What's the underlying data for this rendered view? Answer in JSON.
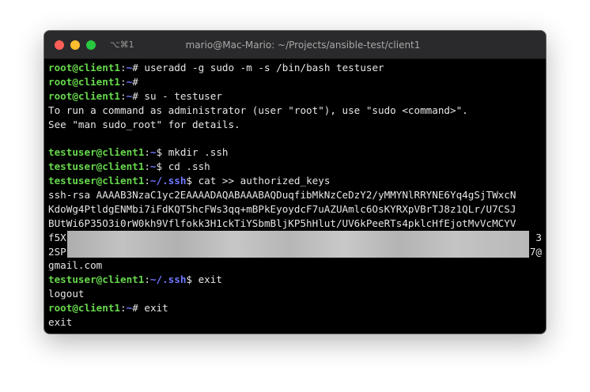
{
  "window": {
    "shortcut": "⌥⌘1",
    "title": "mario@Mac-Mario: ~/Projects/ansible-test/client1"
  },
  "terminal": {
    "lines": [
      {
        "user": "root@client1",
        "sep": ":",
        "path": "~",
        "sym": "# ",
        "cmd": "useradd -g sudo -m -s /bin/bash testuser"
      },
      {
        "user": "root@client1",
        "sep": ":",
        "path": "~",
        "sym": "#",
        "cmd": ""
      },
      {
        "user": "root@client1",
        "sep": ":",
        "path": "~",
        "sym": "# ",
        "cmd": "su - testuser"
      },
      {
        "text": "To run a command as administrator (user \"root\"), use \"sudo <command>\"."
      },
      {
        "text": "See \"man sudo_root\" for details."
      },
      {
        "text": ""
      },
      {
        "user": "testuser@client1",
        "sep": ":",
        "path": "~",
        "sym": "$ ",
        "cmd": "mkdir .ssh"
      },
      {
        "user": "testuser@client1",
        "sep": ":",
        "path": "~",
        "sym": "$ ",
        "cmd": "cd .ssh"
      },
      {
        "user": "testuser@client1",
        "sep": ":",
        "path": "~/.ssh",
        "sym": "$ ",
        "cmd": "cat >> authorized_keys"
      },
      {
        "text": "ssh-rsa AAAAB3NzaC1yc2EAAAADAQABAAABAQDuqfibMkNzCeDzY2/yMMYNlRRYNE6Yq4gSjTWxcN"
      },
      {
        "text": "KdoWg4PtldgENMbi7iFdKQT5hcFWs3qq+mBPkEyoydcF7uAZUAmlc6OsKYRXpVBrTJ8z1QLr/U7CSJ"
      },
      {
        "text": "BUtWi6P35O3i0rW0kh9Vflfokk3H1ckTiYSbmBljKP5hHlut/UV6kPeeRTs4pklcHfEjotMvVcMCYV"
      },
      {
        "text": "f5X",
        "tail": "3",
        "blurred": true
      },
      {
        "text": "2SP",
        "tail": "7@",
        "blurred": true
      },
      {
        "text": "gmail.com"
      },
      {
        "user": "testuser@client1",
        "sep": ":",
        "path": "~/.ssh",
        "sym": "$ ",
        "cmd": "exit"
      },
      {
        "text": "logout"
      },
      {
        "user": "root@client1",
        "sep": ":",
        "path": "~",
        "sym": "# ",
        "cmd": "exit"
      },
      {
        "text": "exit"
      }
    ]
  }
}
